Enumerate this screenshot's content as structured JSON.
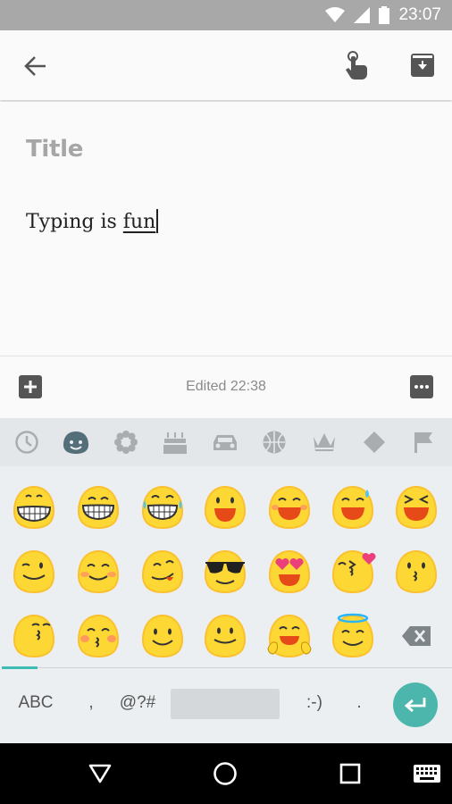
{
  "status_bar": {
    "time": "23:07"
  },
  "app_bar": {
    "back_icon": "arrow-left-icon",
    "reminder_icon": "hand-pointer-icon",
    "archive_icon": "archive-icon"
  },
  "note": {
    "title_placeholder": "Title",
    "body_prefix": "Typing is ",
    "body_word": "fun"
  },
  "bottom_bar": {
    "edited_label": "Edited 22:38",
    "add_icon": "plus-square-icon",
    "more_icon": "more-icon"
  },
  "emoji_categories": [
    "recent-clock-icon",
    "smiley-icon",
    "flower-icon",
    "cake-icon",
    "car-icon",
    "ball-icon",
    "crown-icon",
    "diamond-icon",
    "flag-icon"
  ],
  "emoji_categories_selected": 1,
  "emoji_rows": [
    [
      "grinning",
      "grin",
      "joy",
      "smiley-open",
      "smile",
      "sweat-smile",
      "laughing"
    ],
    [
      "wink",
      "blush",
      "yum",
      "sunglasses",
      "heart-eyes",
      "kissing-heart",
      "kissing"
    ],
    [
      "kissing-closed-eyes",
      "kissing-blush",
      "relaxed",
      "slight-smile",
      "hugging",
      "innocent"
    ]
  ],
  "keyboard_bottom": {
    "abc": "ABC",
    "comma": ",",
    "symbols": "@?#",
    "emoticon": ":-)",
    "period": "."
  },
  "colors": {
    "accent": "#4db6ac",
    "emoji_yellow": "#fbc02d",
    "status_bar": "#a8a8a8"
  }
}
